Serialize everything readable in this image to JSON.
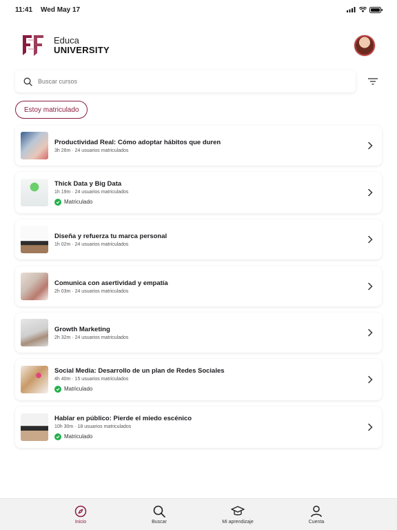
{
  "status_bar": {
    "time": "11:41",
    "date": "Wed May 17"
  },
  "brand": {
    "line1": "Educa",
    "line2": "UNIVERSITY"
  },
  "search": {
    "placeholder": "Buscar cursos"
  },
  "filter_chip": {
    "label": "Estoy matriculado"
  },
  "courses": [
    {
      "title": "Productividad Real: Cómo adoptar hábitos que duren",
      "meta": "3h 26m · 24 usuarios matriculados",
      "enrolled": false
    },
    {
      "title": "Thick Data y Big Data",
      "meta": "1h 19m · 24 usuarios matriculados",
      "enrolled": true,
      "enrolled_label": "Matriculado"
    },
    {
      "title": "Diseña y refuerza tu marca personal",
      "meta": "1h 02m · 24 usuarios matriculados",
      "enrolled": false
    },
    {
      "title": "Comunica con asertividad y empatía",
      "meta": "2h 03m · 24 usuarios matriculados",
      "enrolled": false
    },
    {
      "title": "Growth Marketing",
      "meta": "2h 32m · 24 usuarios matriculados",
      "enrolled": false
    },
    {
      "title": "Social Media: Desarrollo de un plan de Redes Sociales",
      "meta": "4h 40m · 15 usuarios matriculados",
      "enrolled": true,
      "enrolled_label": "Matriculado"
    },
    {
      "title": "Hablar en público: Pierde el miedo escénico",
      "meta": "10h 30m · 18 usuarios matriculados",
      "enrolled": true,
      "enrolled_label": "Matriculado"
    }
  ],
  "tabs": [
    {
      "label": "Inicio",
      "icon": "compass-icon",
      "active": true
    },
    {
      "label": "Buscar",
      "icon": "search-icon",
      "active": false
    },
    {
      "label": "Mi aprendizaje",
      "icon": "graduation-cap-icon",
      "active": false
    },
    {
      "label": "Cuenta",
      "icon": "person-icon",
      "active": false
    }
  ],
  "colors": {
    "accent": "#8b1b3e",
    "success": "#22b04b"
  }
}
